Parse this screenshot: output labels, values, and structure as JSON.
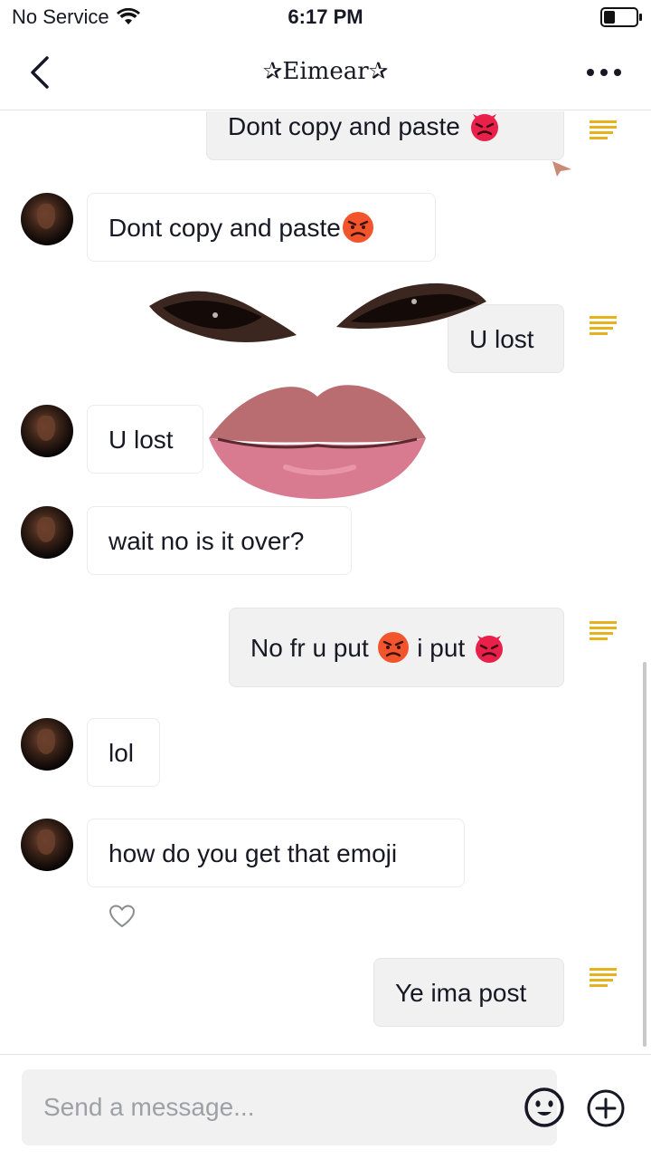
{
  "status_bar": {
    "carrier": "No Service",
    "time": "6:17 PM",
    "battery_level": 0.35
  },
  "header": {
    "title": "✰Eimear✰"
  },
  "messages": [
    {
      "side": "out",
      "text": "Dont copy and paste",
      "emoji": "devil"
    },
    {
      "side": "in",
      "text": "Dont copy and paste",
      "emoji": "angry"
    },
    {
      "side": "out",
      "text": "U lost"
    },
    {
      "side": "in",
      "text": "U lost"
    },
    {
      "side": "in",
      "text": "wait no is it over?"
    },
    {
      "side": "out",
      "text": "No fr u put",
      "emoji": "angry",
      "text2": "i put",
      "emoji2": "devil"
    },
    {
      "side": "in",
      "text": "lol"
    },
    {
      "side": "in",
      "text": "how do you get that emoji",
      "liked": true
    },
    {
      "side": "out",
      "text": "Ye ima post"
    }
  ],
  "composer": {
    "placeholder": "Send a message..."
  },
  "icons": {
    "back": "chevron-left-icon",
    "more": "more-horizontal-icon",
    "emoji": "emoji-face-icon",
    "add": "plus-circle-icon",
    "like": "heart-outline-icon"
  },
  "colors": {
    "devil_emoji": "#e8204a",
    "angry_emoji": "#f2552c",
    "outgoing_bubble": "#f1f1f2"
  }
}
